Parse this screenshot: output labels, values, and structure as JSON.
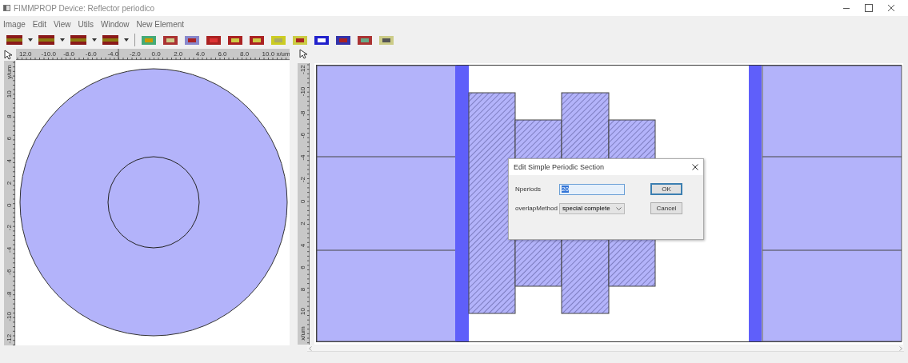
{
  "window": {
    "title": "FIMMPROP Device: Reflector periodico"
  },
  "menu": [
    {
      "label": "Image"
    },
    {
      "label": "Edit"
    },
    {
      "label": "View"
    },
    {
      "label": "Utils"
    },
    {
      "label": "Window"
    },
    {
      "label": "New Element"
    }
  ],
  "cross_section_view": {
    "x_ruler": [
      "12.0",
      "-10.0",
      "-8.0",
      "-6.0",
      "-4.0",
      "-2.0",
      "0.0",
      "2.0",
      "4.0",
      "6.0",
      "8.0",
      "10.0 x/um"
    ],
    "y_ruler": [
      "y/um",
      "10",
      "8",
      "6",
      "4",
      "2",
      "0",
      "-2",
      "-4",
      "-6",
      "-8",
      "-10",
      "-12"
    ]
  },
  "layout_view": {
    "y_ruler": [
      "-12",
      "-10",
      "-8",
      "-6",
      "-4",
      "-2",
      "0",
      "2",
      "4",
      "6",
      "8",
      "10",
      "x/um"
    ]
  },
  "dialog": {
    "title": "Edit Simple Periodic Section",
    "fields": [
      {
        "kind": "text",
        "label": "Nperiods",
        "value": "20",
        "text_selected": true
      },
      {
        "kind": "dropdown",
        "label": "overlapMethod",
        "value": "special complete",
        "text_selected": false
      }
    ],
    "buttons": [
      {
        "label": "OK",
        "default": true
      },
      {
        "label": "Cancel",
        "default": false
      }
    ]
  }
}
